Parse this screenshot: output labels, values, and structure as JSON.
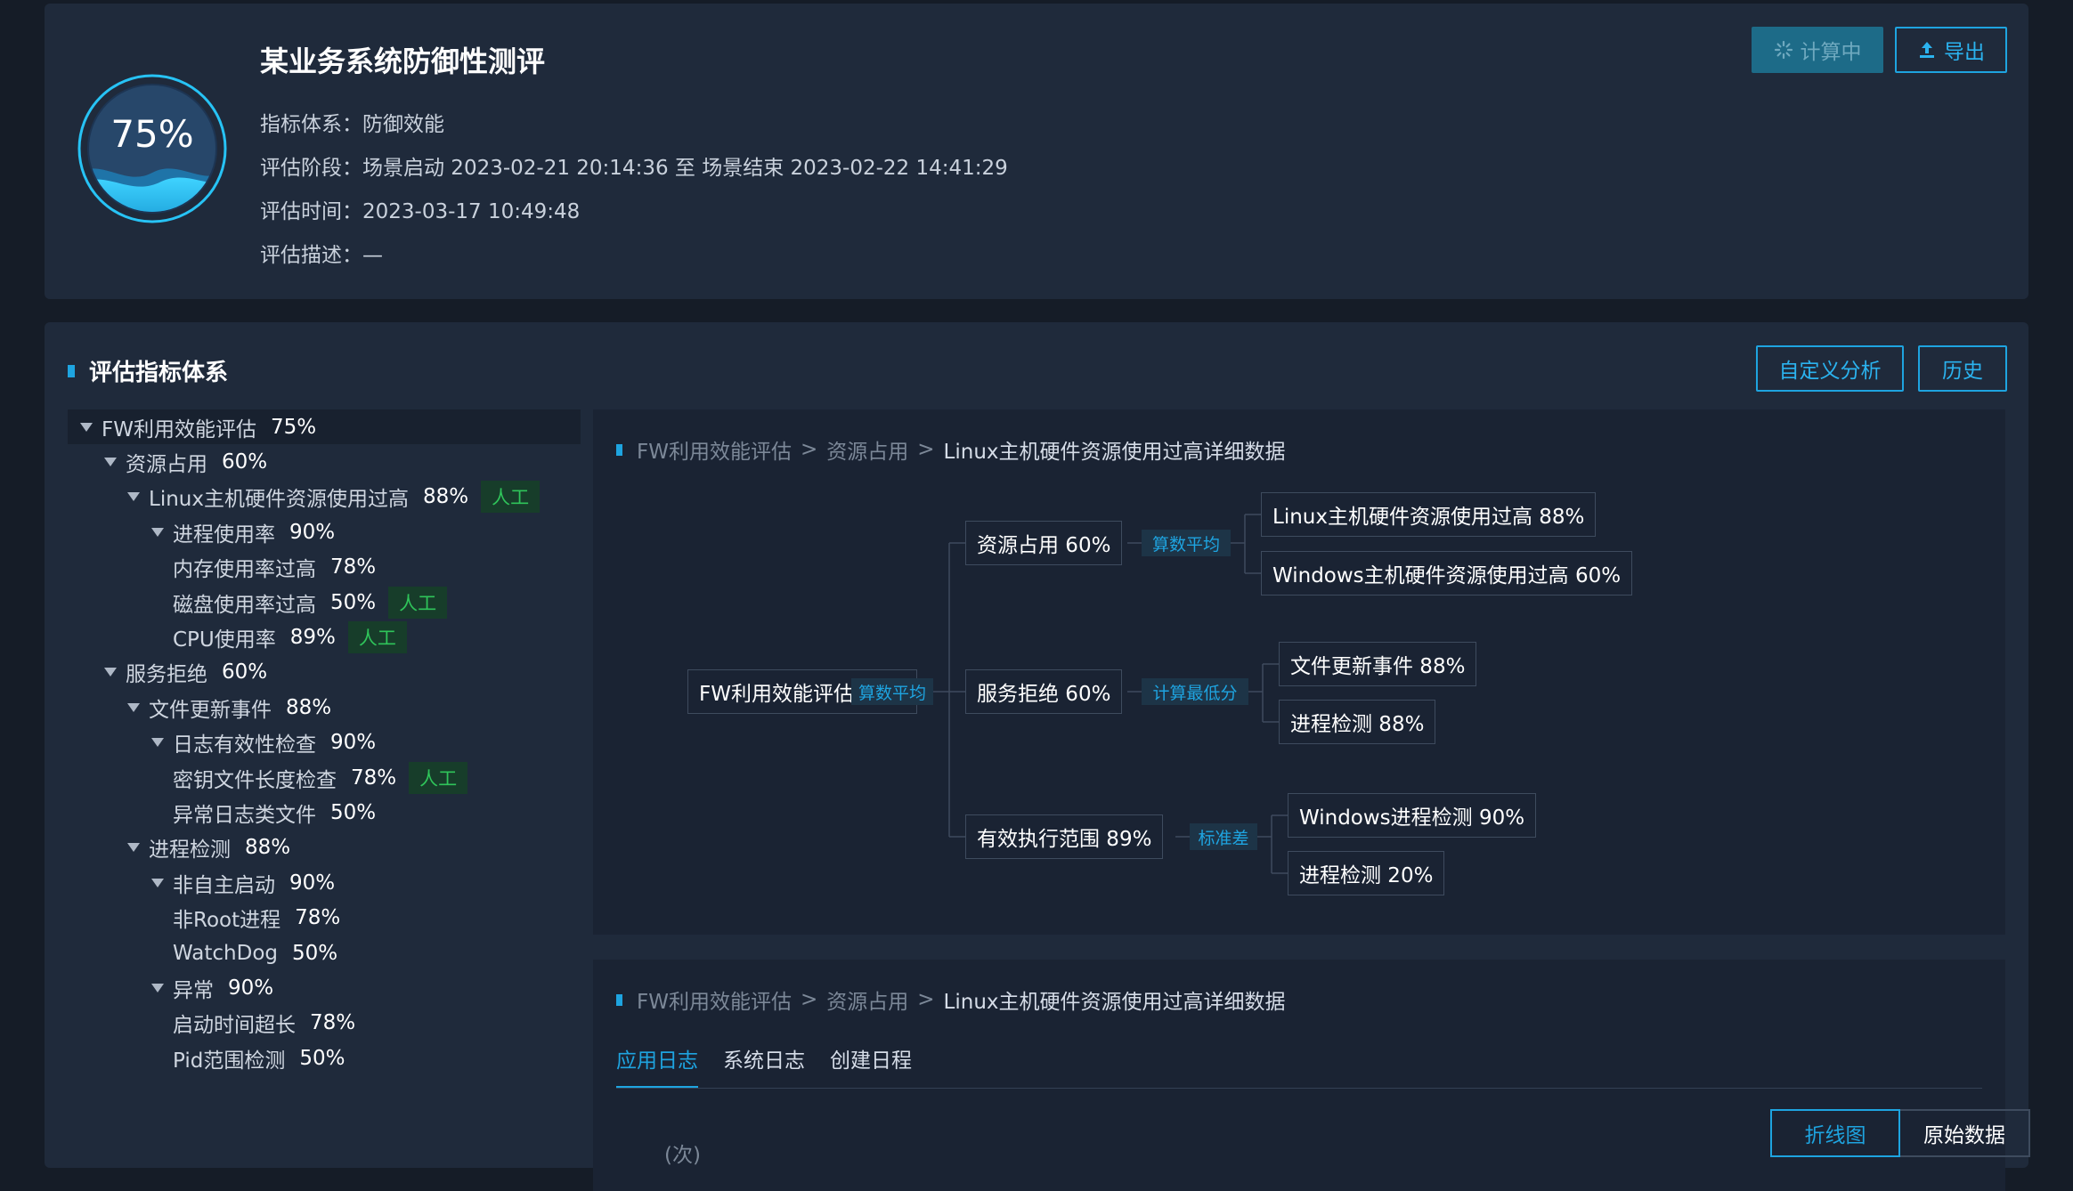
{
  "header": {
    "score": "75%",
    "title": "某业务系统防御性测评",
    "meta": [
      {
        "label": "指标体系：",
        "value": "防御效能"
      },
      {
        "label": "评估阶段：",
        "value": "场景启动 2023-02-21 20:14:36 至 场景结束 2023-02-22 14:41:29"
      },
      {
        "label": "评估时间：",
        "value": "2023-03-17 10:49:48"
      },
      {
        "label": "评估描述：",
        "value": "—"
      }
    ],
    "calc_label": "计算中",
    "export_label": "导出",
    "score_fraction": 0.75
  },
  "section": {
    "title": "评估指标体系",
    "custom_label": "自定义分析",
    "history_label": "历史"
  },
  "tree": [
    {
      "name": "FW利用效能评估",
      "pct": "75%",
      "caret": true,
      "level": 0,
      "selected": true
    },
    {
      "name": "资源占用",
      "pct": "60%",
      "caret": true,
      "level": 1
    },
    {
      "name": "Linux主机硬件资源使用过高",
      "pct": "88%",
      "caret": true,
      "level": 2,
      "tag": "人工"
    },
    {
      "name": "进程使用率",
      "pct": "90%",
      "caret": true,
      "level": 3
    },
    {
      "name": "内存使用率过高",
      "pct": "78%",
      "level": 4
    },
    {
      "name": "磁盘使用率过高",
      "pct": "50%",
      "level": 4,
      "tag": "人工"
    },
    {
      "name": "CPU使用率",
      "pct": "89%",
      "level": 4,
      "tag": "人工"
    },
    {
      "name": "服务拒绝",
      "pct": "60%",
      "caret": true,
      "level": 1
    },
    {
      "name": "文件更新事件",
      "pct": "88%",
      "caret": true,
      "level": 2
    },
    {
      "name": "日志有效性检查",
      "pct": "90%",
      "caret": true,
      "level": 3
    },
    {
      "name": "密钥文件长度检查",
      "pct": "78%",
      "level": 4,
      "tag": "人工"
    },
    {
      "name": "异常日志类文件",
      "pct": "50%",
      "level": 4
    },
    {
      "name": "进程检测",
      "pct": "88%",
      "caret": true,
      "level": 2
    },
    {
      "name": "非自主启动",
      "pct": "90%",
      "caret": true,
      "level": 3
    },
    {
      "name": "非Root进程",
      "pct": "78%",
      "level": 4
    },
    {
      "name": "WatchDog",
      "pct": "50%",
      "level": 4
    },
    {
      "name": "异常",
      "pct": "90%",
      "caret": true,
      "level": 3
    },
    {
      "name": "启动时间超长",
      "pct": "78%",
      "level": 4
    },
    {
      "name": "Pid范围检测",
      "pct": "50%",
      "level": 4
    }
  ],
  "breadcrumb": [
    "FW利用效能评估",
    "资源占用",
    "Linux主机硬件资源使用过高详细数据"
  ],
  "breadcrumb_sep": ">",
  "flow": {
    "root": "FW利用效能评估  75%",
    "root_op": "算数平均",
    "mid": [
      {
        "label": "资源占用  60%",
        "op": "算数平均",
        "children": [
          "Linux主机硬件资源使用过高  88%",
          "Windows主机硬件资源使用过高  60%"
        ]
      },
      {
        "label": "服务拒绝  60%",
        "op": "计算最低分",
        "children": [
          "文件更新事件  88%",
          "进程检测  88%"
        ]
      },
      {
        "label": "有效执行范围  89%",
        "op": "标准差",
        "children": [
          "Windows进程检测  90%",
          "进程检测  20%"
        ]
      }
    ]
  },
  "bottom": {
    "tabs": [
      "应用日志",
      "系统日志",
      "创建日程"
    ],
    "active_tab": 0,
    "seg_line": "折线图",
    "seg_raw": "原始数据",
    "unit": "(次)"
  }
}
